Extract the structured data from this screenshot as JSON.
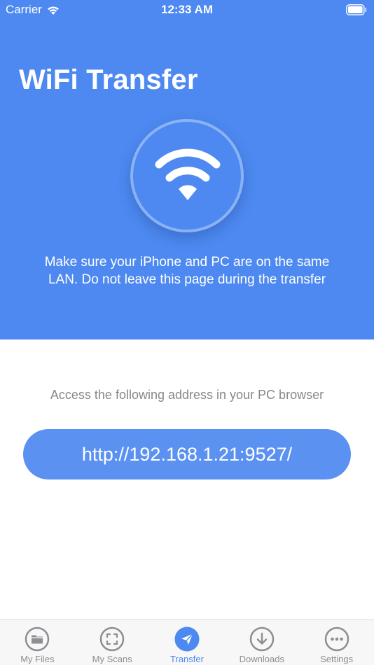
{
  "status_bar": {
    "carrier": "Carrier",
    "time": "12:33 AM"
  },
  "hero": {
    "title": "WiFi Transfer",
    "hint": "Make sure your iPhone and PC are on the same LAN. Do not leave this page during the transfer",
    "background_color": "#4d89f0",
    "icon": "wifi-icon"
  },
  "address": {
    "caption": "Access the following address in your PC browser",
    "url": "http://192.168.1.21:9527/"
  },
  "tab_bar": {
    "active_index": 2,
    "tabs": [
      {
        "label": "My Files",
        "icon": "folder-icon"
      },
      {
        "label": "My Scans",
        "icon": "scan-icon"
      },
      {
        "label": "Transfer",
        "icon": "send-icon"
      },
      {
        "label": "Downloads",
        "icon": "download-icon"
      },
      {
        "label": "Settings",
        "icon": "more-icon"
      }
    ]
  }
}
